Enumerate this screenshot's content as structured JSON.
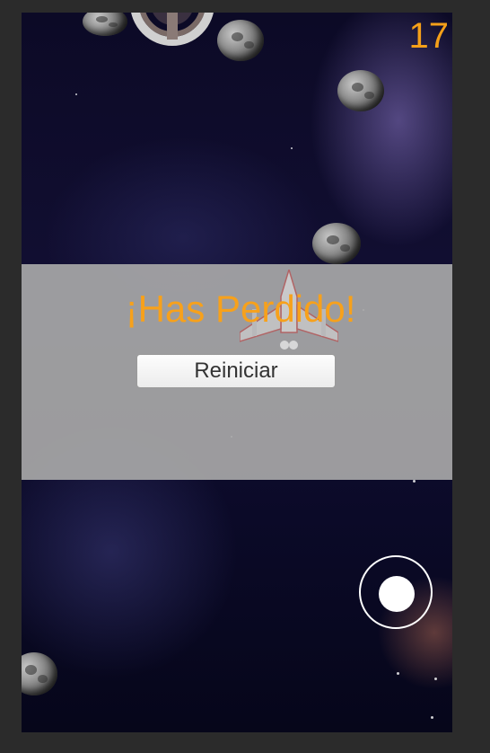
{
  "hud": {
    "score": "17"
  },
  "game_over": {
    "title": "¡Has Perdido!",
    "restart_label": "Reiniciar"
  },
  "colors": {
    "accent": "#f5a019",
    "overlay": "#a8a8a8",
    "space": "#0c0a26"
  },
  "icons": {
    "joystick": "virtual-joystick-icon",
    "ship": "spaceship-icon",
    "station": "space-station-icon",
    "asteroid": "asteroid-icon"
  }
}
